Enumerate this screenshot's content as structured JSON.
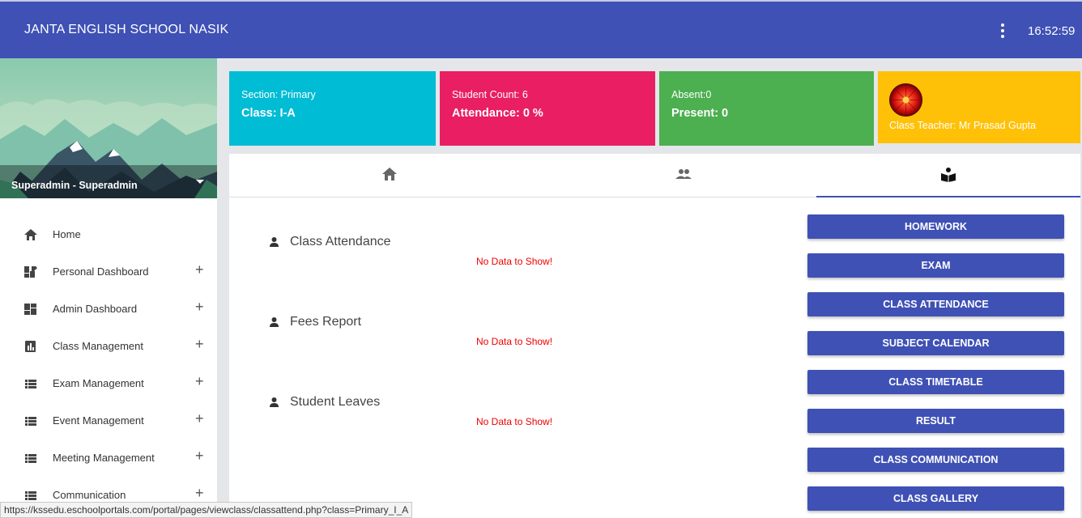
{
  "header": {
    "school_name": "JANTA ENGLISH SCHOOL NASIK",
    "time": "16:52:59",
    "menu_icon": "more-vert-icon"
  },
  "sidebar": {
    "user": "Superadmin - Superadmin",
    "items": [
      {
        "label": "Home",
        "icon": "home-icon",
        "expandable": false
      },
      {
        "label": "Personal Dashboard",
        "icon": "dashboard-edit-icon",
        "expandable": true
      },
      {
        "label": "Admin Dashboard",
        "icon": "dashboard-icon",
        "expandable": true
      },
      {
        "label": "Class Management",
        "icon": "chart-icon",
        "expandable": true
      },
      {
        "label": "Exam Management",
        "icon": "list-icon",
        "expandable": true
      },
      {
        "label": "Event Management",
        "icon": "list-icon",
        "expandable": true
      },
      {
        "label": "Meeting Management",
        "icon": "list-icon",
        "expandable": true
      },
      {
        "label": "Communication",
        "icon": "list-icon",
        "expandable": true
      }
    ],
    "expand_symbol": "+"
  },
  "cards": {
    "section": {
      "line1": "Section: Primary",
      "line2": "Class: I-A",
      "color": "#00bcd4"
    },
    "student": {
      "line1": "Student Count: 6",
      "line2": "Attendance: 0 %",
      "color": "#e91e63"
    },
    "absent": {
      "line1": "Absent:0",
      "line2": "Present: 0",
      "color": "#4caf50"
    },
    "teacher": {
      "name": "Class Teacher: Mr Prasad Gupta",
      "color": "#ffc107"
    }
  },
  "tabs": [
    {
      "icon": "home-icon",
      "active": false
    },
    {
      "icon": "people-icon",
      "active": false
    },
    {
      "icon": "book-reader-icon",
      "active": true
    }
  ],
  "sections": [
    {
      "title": "Class Attendance",
      "message": "No Data to Show!"
    },
    {
      "title": "Fees Report",
      "message": "No Data to Show!"
    },
    {
      "title": "Student Leaves",
      "message": "No Data to Show!"
    }
  ],
  "buttons": [
    "HOMEWORK",
    "EXAM",
    "CLASS ATTENDANCE",
    "SUBJECT CALENDAR",
    "CLASS TIMETABLE",
    "RESULT",
    "CLASS COMMUNICATION",
    "CLASS GALLERY"
  ],
  "status_url": "https://kssedu.eschoolportals.com/portal/pages/viewclass/classattend.php?class=Primary_I_A"
}
